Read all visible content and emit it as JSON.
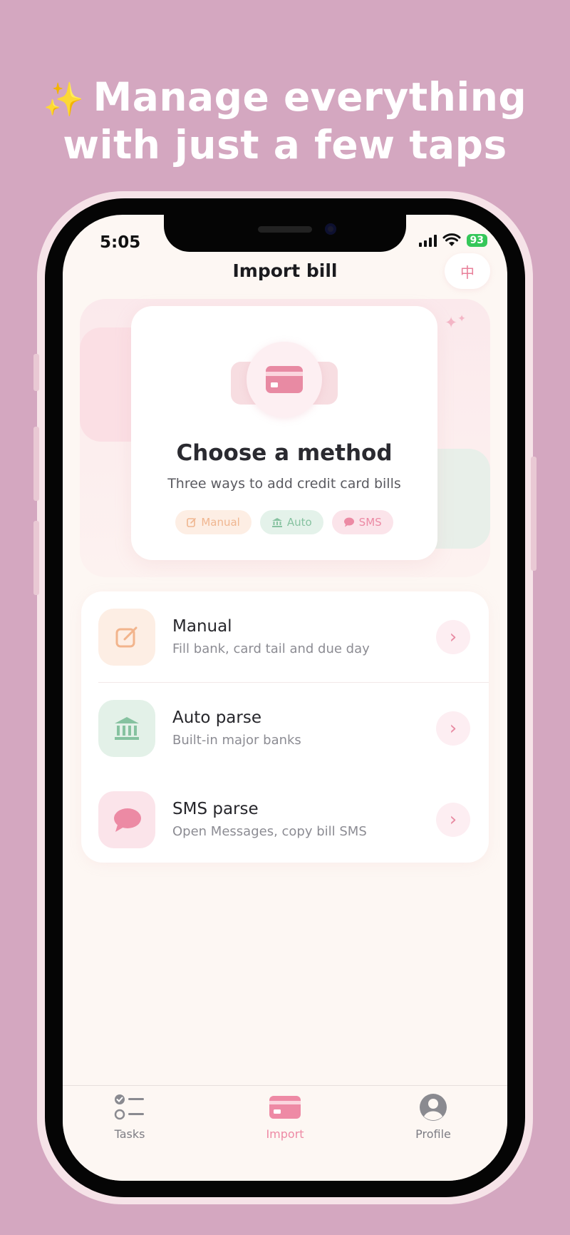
{
  "headline": {
    "sparkle": "✨",
    "line1": "Manage everything",
    "line2": "with just a few taps"
  },
  "status_bar": {
    "time": "5:05",
    "battery": "93"
  },
  "nav": {
    "title": "Import bill",
    "lang_button": "中"
  },
  "hero": {
    "title": "Choose a method",
    "subtitle": "Three ways to add credit card bills",
    "chips": [
      {
        "label": "Manual",
        "icon": "edit-icon"
      },
      {
        "label": "Auto",
        "icon": "bank-icon"
      },
      {
        "label": "SMS",
        "icon": "chat-bubble-icon"
      }
    ]
  },
  "methods": [
    {
      "title": "Manual",
      "subtitle": "Fill bank, card tail and due day",
      "icon": "edit-icon"
    },
    {
      "title": "Auto parse",
      "subtitle": "Built-in major banks",
      "icon": "bank-icon"
    },
    {
      "title": "SMS parse",
      "subtitle": "Open Messages, copy bill SMS",
      "icon": "chat-bubble-icon"
    }
  ],
  "tabbar": {
    "items": [
      {
        "label": "Tasks",
        "icon": "checklist-icon",
        "active": false
      },
      {
        "label": "Import",
        "icon": "card-icon",
        "active": true
      },
      {
        "label": "Profile",
        "icon": "person-icon",
        "active": false
      }
    ]
  },
  "colors": {
    "background": "#d4a7c0",
    "accent": "#ee8aa5",
    "manual": "#f0b690",
    "auto": "#86c2a0",
    "sms": "#ec8aa4"
  }
}
